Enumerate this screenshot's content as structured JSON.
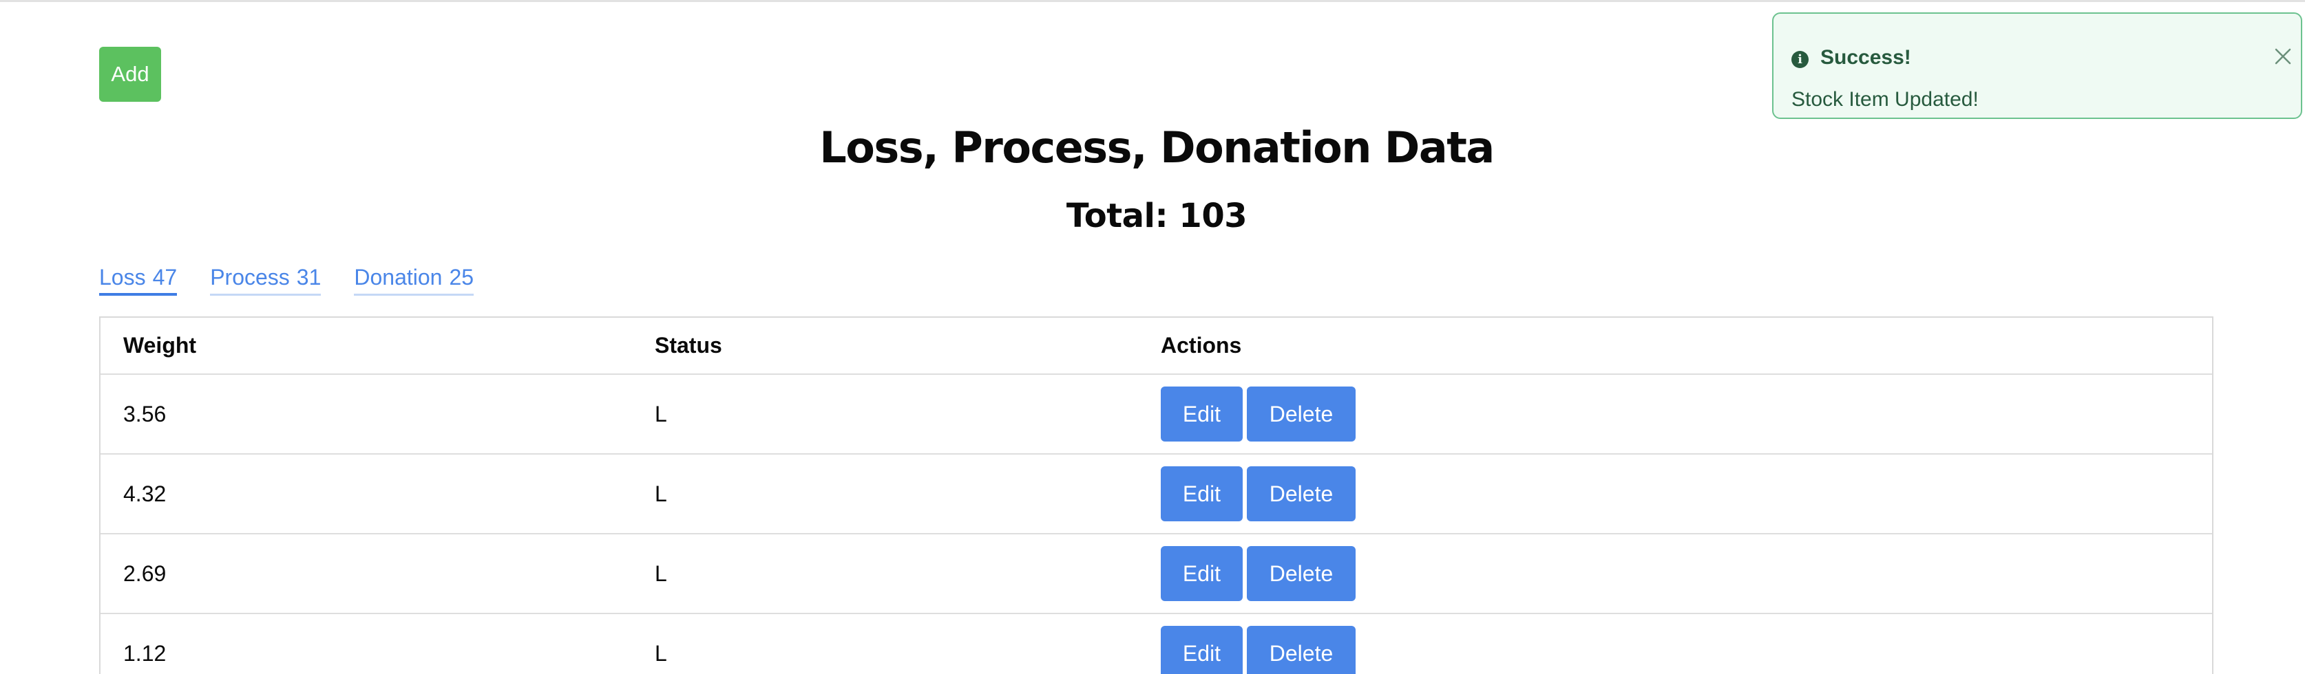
{
  "toolbar": {
    "add_label": "Add"
  },
  "header": {
    "title": "Loss, Process, Donation Data",
    "total": "Total: 103"
  },
  "tabs": [
    {
      "label": "Loss",
      "count": "47",
      "active": true
    },
    {
      "label": "Process",
      "count": "31",
      "active": false
    },
    {
      "label": "Donation",
      "count": "25",
      "active": false
    }
  ],
  "table": {
    "columns": [
      "Weight",
      "Status",
      "Actions"
    ],
    "rows": [
      {
        "weight": "3.56",
        "status": "L"
      },
      {
        "weight": "4.32",
        "status": "L"
      },
      {
        "weight": "2.69",
        "status": "L"
      },
      {
        "weight": "1.12",
        "status": "L"
      }
    ],
    "edit_label": "Edit",
    "delete_label": "Delete"
  },
  "toast": {
    "icon": "info-icon",
    "title": "Success!",
    "message": "Stock Item Updated!",
    "close_icon": "close-icon"
  },
  "colors": {
    "add_button": "#5cc15f",
    "action_button": "#4a86e8",
    "link": "#4a86e8",
    "toast_background": "#effaf3",
    "toast_border": "#6cc28f",
    "toast_text": "#275a3e"
  }
}
